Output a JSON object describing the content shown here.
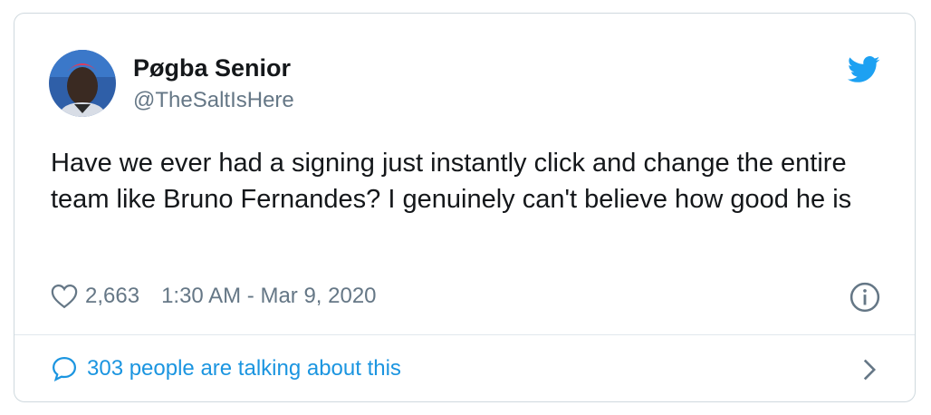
{
  "author": {
    "name": "Pøgba Senior",
    "handle": "@TheSaltIsHere",
    "avatar_icon": "avatar-photo"
  },
  "tweet": {
    "text": "Have we ever had a signing just instantly click and change the entire team like Bruno Fernandes? I genuinely can't believe how good he is"
  },
  "meta": {
    "likes": "2,663",
    "timestamp": "1:30 AM - Mar 9, 2020"
  },
  "footer": {
    "talking_label": "303 people are talking about this"
  },
  "icons": {
    "brand": "twitter-bird-icon",
    "like": "heart-icon",
    "info": "info-icon",
    "comment": "speech-bubble-icon",
    "chevron": "chevron-right-icon"
  },
  "colors": {
    "accent": "#1da1f2",
    "link": "#1b95e0",
    "muted": "#657786",
    "text": "#14171a",
    "border": "#cfd9de"
  }
}
